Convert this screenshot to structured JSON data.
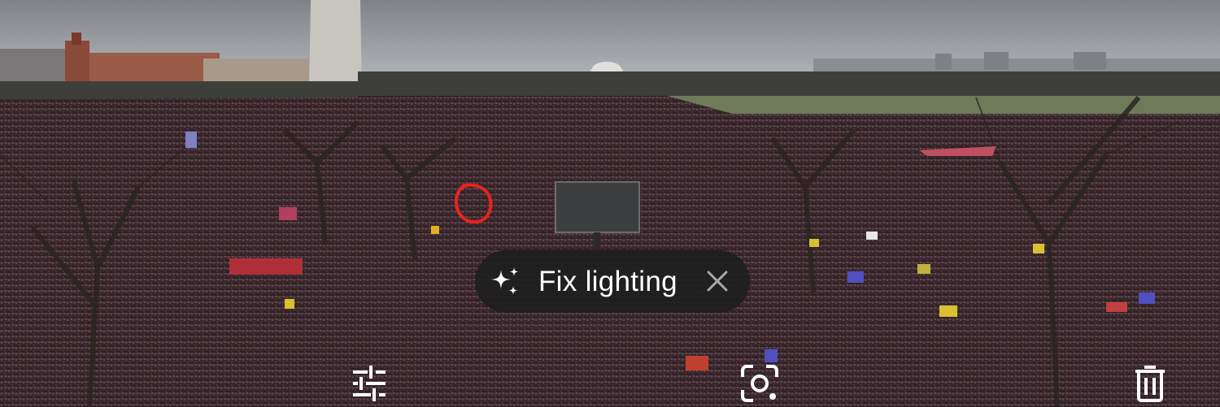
{
  "photo": {
    "subject": "crowd-on-national-mall-photo"
  },
  "suggestion_chip": {
    "label": "Fix lighting",
    "icon": "sparkle-icon",
    "dismiss_icon": "close-icon"
  },
  "bottom_toolbar": {
    "edit_icon": "sliders-icon",
    "lens_icon": "lens-icon",
    "delete_icon": "trash-icon"
  },
  "colors": {
    "chip_bg": "#1e1e20",
    "chip_text": "#ffffff",
    "annotation": "#e8241c"
  }
}
